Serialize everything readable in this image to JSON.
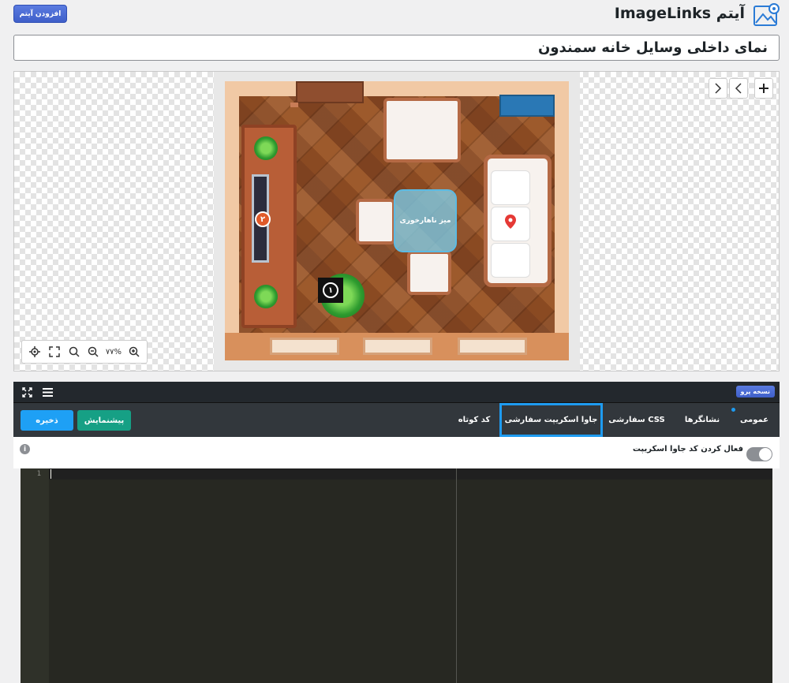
{
  "header": {
    "title": "آیتم ImageLinks",
    "add_item_label": "افزودن آیتم"
  },
  "item_title": "نمای داخلی وسایل خانه سمندون",
  "canvas": {
    "hotspot_label": "میز ناهارخوری",
    "marker_1": "۱",
    "marker_2": "۲",
    "zoom_level": "۷۷%"
  },
  "panel": {
    "pro_label": "نسخه پرو",
    "tabs": [
      {
        "label": "عمومی"
      },
      {
        "label": "نشانگرها"
      },
      {
        "label": "CSS سفارشی"
      },
      {
        "label": "جاوا اسکریپت سفارشی"
      },
      {
        "label": "کد کوتاه"
      }
    ],
    "active_tab_index": 3,
    "save_label": "ذخیره",
    "preview_label": "پیشنمایش",
    "js_toggle_label": "فعال کردن کد جاوا اسکریپت",
    "js_toggle_on": false
  },
  "editor": {
    "line_numbers": [
      "1"
    ]
  },
  "colors": {
    "accent_blue": "#1ea0f5",
    "preview_teal": "#16a085",
    "panel_dark": "#32373c",
    "editor_bg": "#272822"
  }
}
